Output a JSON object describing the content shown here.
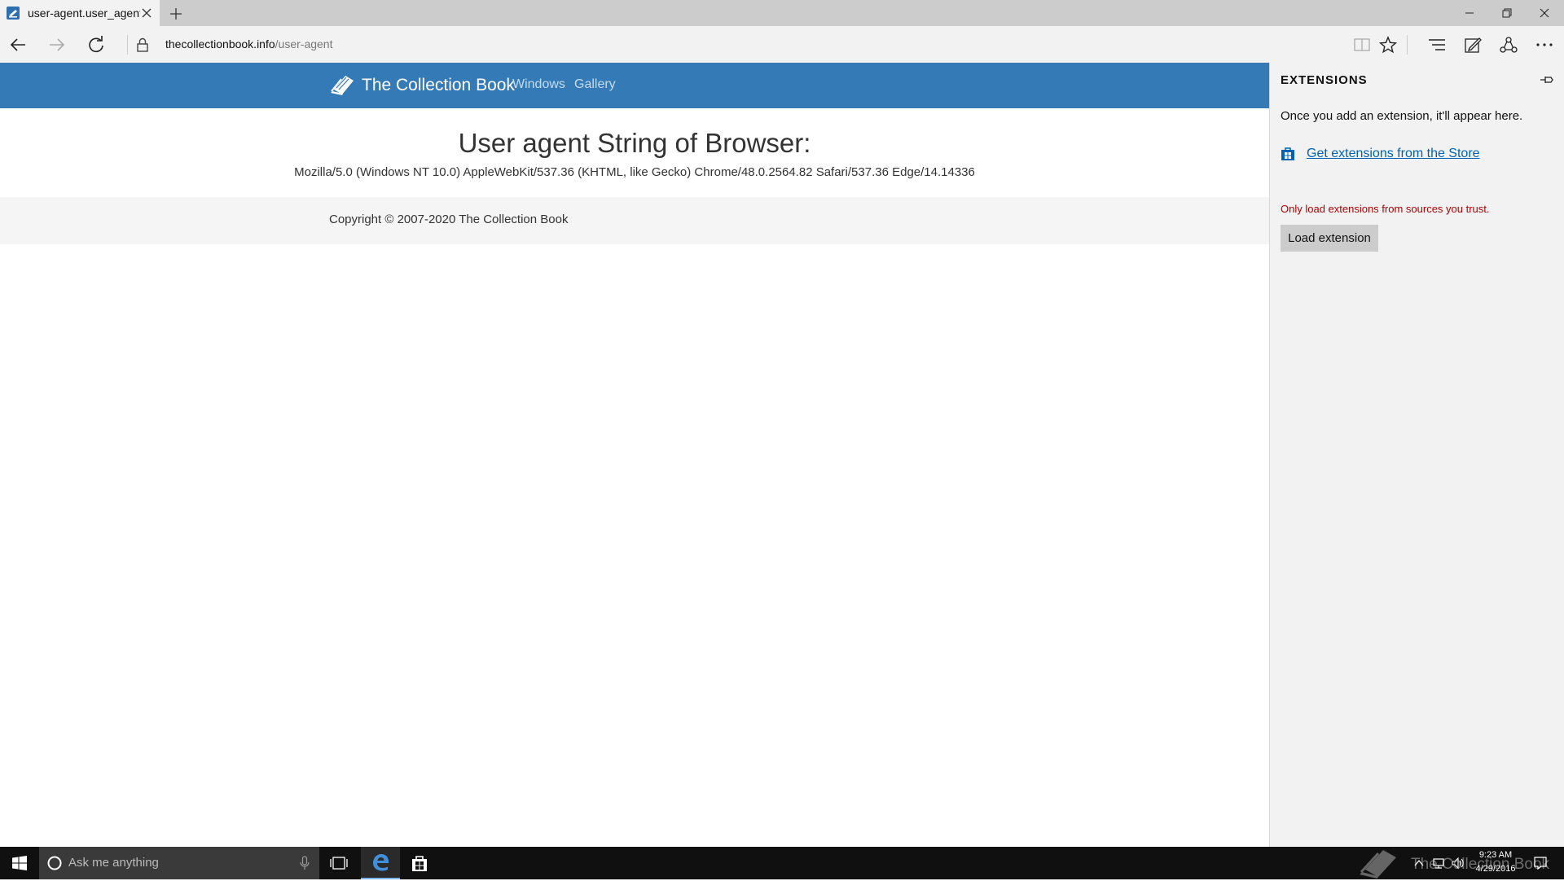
{
  "browser": {
    "tab": {
      "title": "user-agent.user_agent -"
    },
    "address": {
      "domain": "thecollectionbook.info",
      "path": "/user-agent"
    }
  },
  "site": {
    "brand": "The Collection Book",
    "nav": [
      "Windows",
      "Gallery"
    ],
    "heading": "User agent String of Browser:",
    "user_agent": "Mozilla/5.0 (Windows NT 10.0) AppleWebKit/537.36 (KHTML, like Gecko) Chrome/48.0.2564.82 Safari/537.36 Edge/14.14336",
    "footer": "Copyright © 2007-2020 The Collection Book"
  },
  "extensions_pane": {
    "title": "EXTENSIONS",
    "empty_message": "Once you add an extension, it'll appear here.",
    "store_link": "Get extensions from the Store",
    "warning": "Only load extensions from sources you trust.",
    "load_button": "Load extension"
  },
  "taskbar": {
    "search_placeholder": "Ask me anything",
    "watermark": "The Collection Book",
    "time": "9:23 AM",
    "date": "4/29/2016"
  },
  "colors": {
    "site_nav": "#337ab7",
    "warning": "#b00000",
    "link": "#0063b1",
    "taskbar": "#101010"
  },
  "icons": [
    "tab-favicon-icon",
    "close-icon",
    "plus-icon",
    "minimize-icon",
    "restore-icon",
    "back-arrow-icon",
    "forward-arrow-icon",
    "refresh-icon",
    "lock-icon",
    "reading-view-icon",
    "star-icon",
    "hub-icon",
    "web-note-icon",
    "share-icon",
    "more-icon",
    "pin-icon",
    "store-icon",
    "windows-logo-icon",
    "cortana-circle-icon",
    "microphone-icon",
    "task-view-icon",
    "edge-icon",
    "store-bag-icon"
  ]
}
